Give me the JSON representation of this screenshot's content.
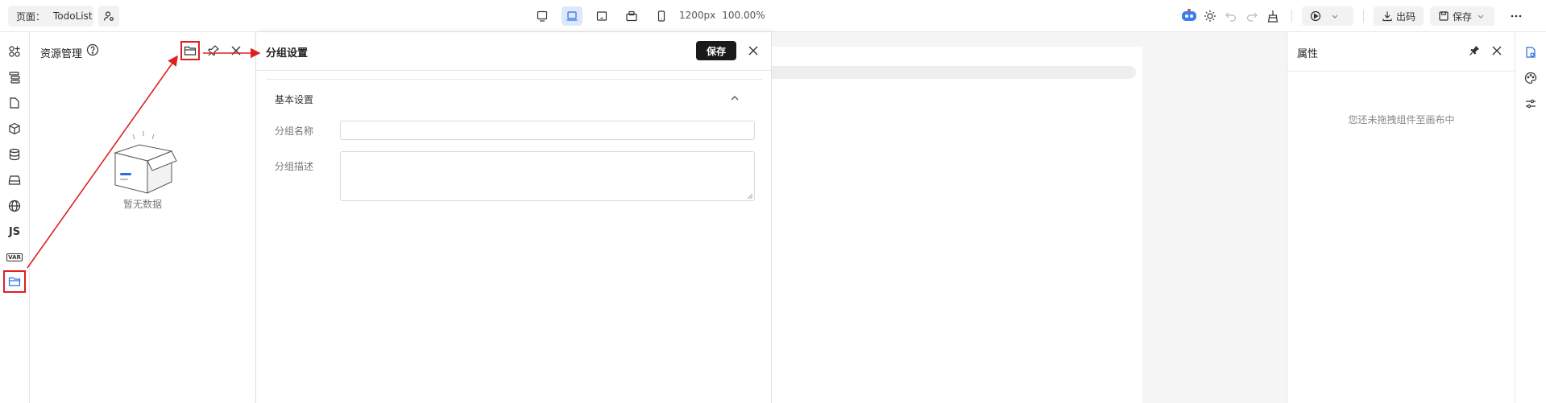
{
  "header": {
    "page_label": "页面：",
    "page_name": "TodoList",
    "width_value": "1200px",
    "zoom_value": "100.00%",
    "export_label": "出码",
    "save_label": "保存"
  },
  "resource_panel": {
    "title": "资源管理",
    "empty_text": "暂无数据"
  },
  "group_panel": {
    "title": "分组设置",
    "save_label": "保存",
    "section_title": "基本设置",
    "name_label": "分组名称",
    "desc_label": "分组描述",
    "name_value": "",
    "desc_value": ""
  },
  "rail": {
    "js_label": "JS",
    "var_label": "VAR"
  },
  "properties_panel": {
    "title": "属性",
    "empty_text": "您还未拖拽组件至画布中"
  },
  "colors": {
    "annotation": "#e02020",
    "active_device": "#dde8fb",
    "primary_button": "#1a1a1a"
  }
}
